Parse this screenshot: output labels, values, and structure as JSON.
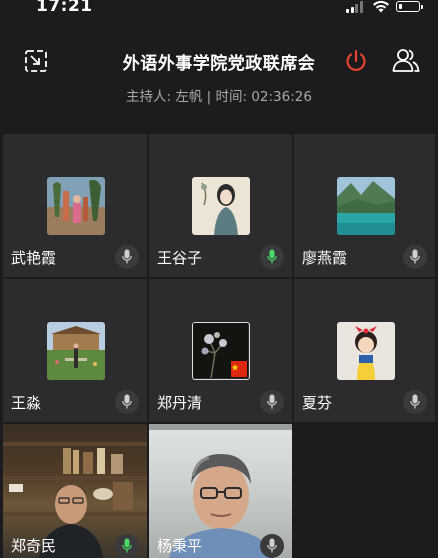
{
  "status_bar": {
    "time": "17:21",
    "battery_level": 0.15
  },
  "meeting": {
    "title": "外语外事学院党政联席会",
    "subtitle": "主持人: 左帆 | 时间: 02:36:26"
  },
  "icons": {
    "minimize": "minimize-window-icon",
    "leave": "power-icon",
    "participants": "participants-icon"
  },
  "colors": {
    "leave": "#e3442f",
    "mic_active": "#4cd964",
    "tile_bg": "#2c2c2e"
  },
  "participants": [
    {
      "name": "武艳霞",
      "mic": "muted"
    },
    {
      "name": "王谷子",
      "mic": "active"
    },
    {
      "name": "廖燕霞",
      "mic": "muted"
    },
    {
      "name": "王淼",
      "mic": "muted"
    },
    {
      "name": "郑丹清",
      "mic": "muted"
    },
    {
      "name": "夏芬",
      "mic": "muted"
    },
    {
      "name": "郑奇民",
      "mic": "active",
      "video": true
    },
    {
      "name": "杨秉平",
      "mic": "muted",
      "video": true
    }
  ]
}
